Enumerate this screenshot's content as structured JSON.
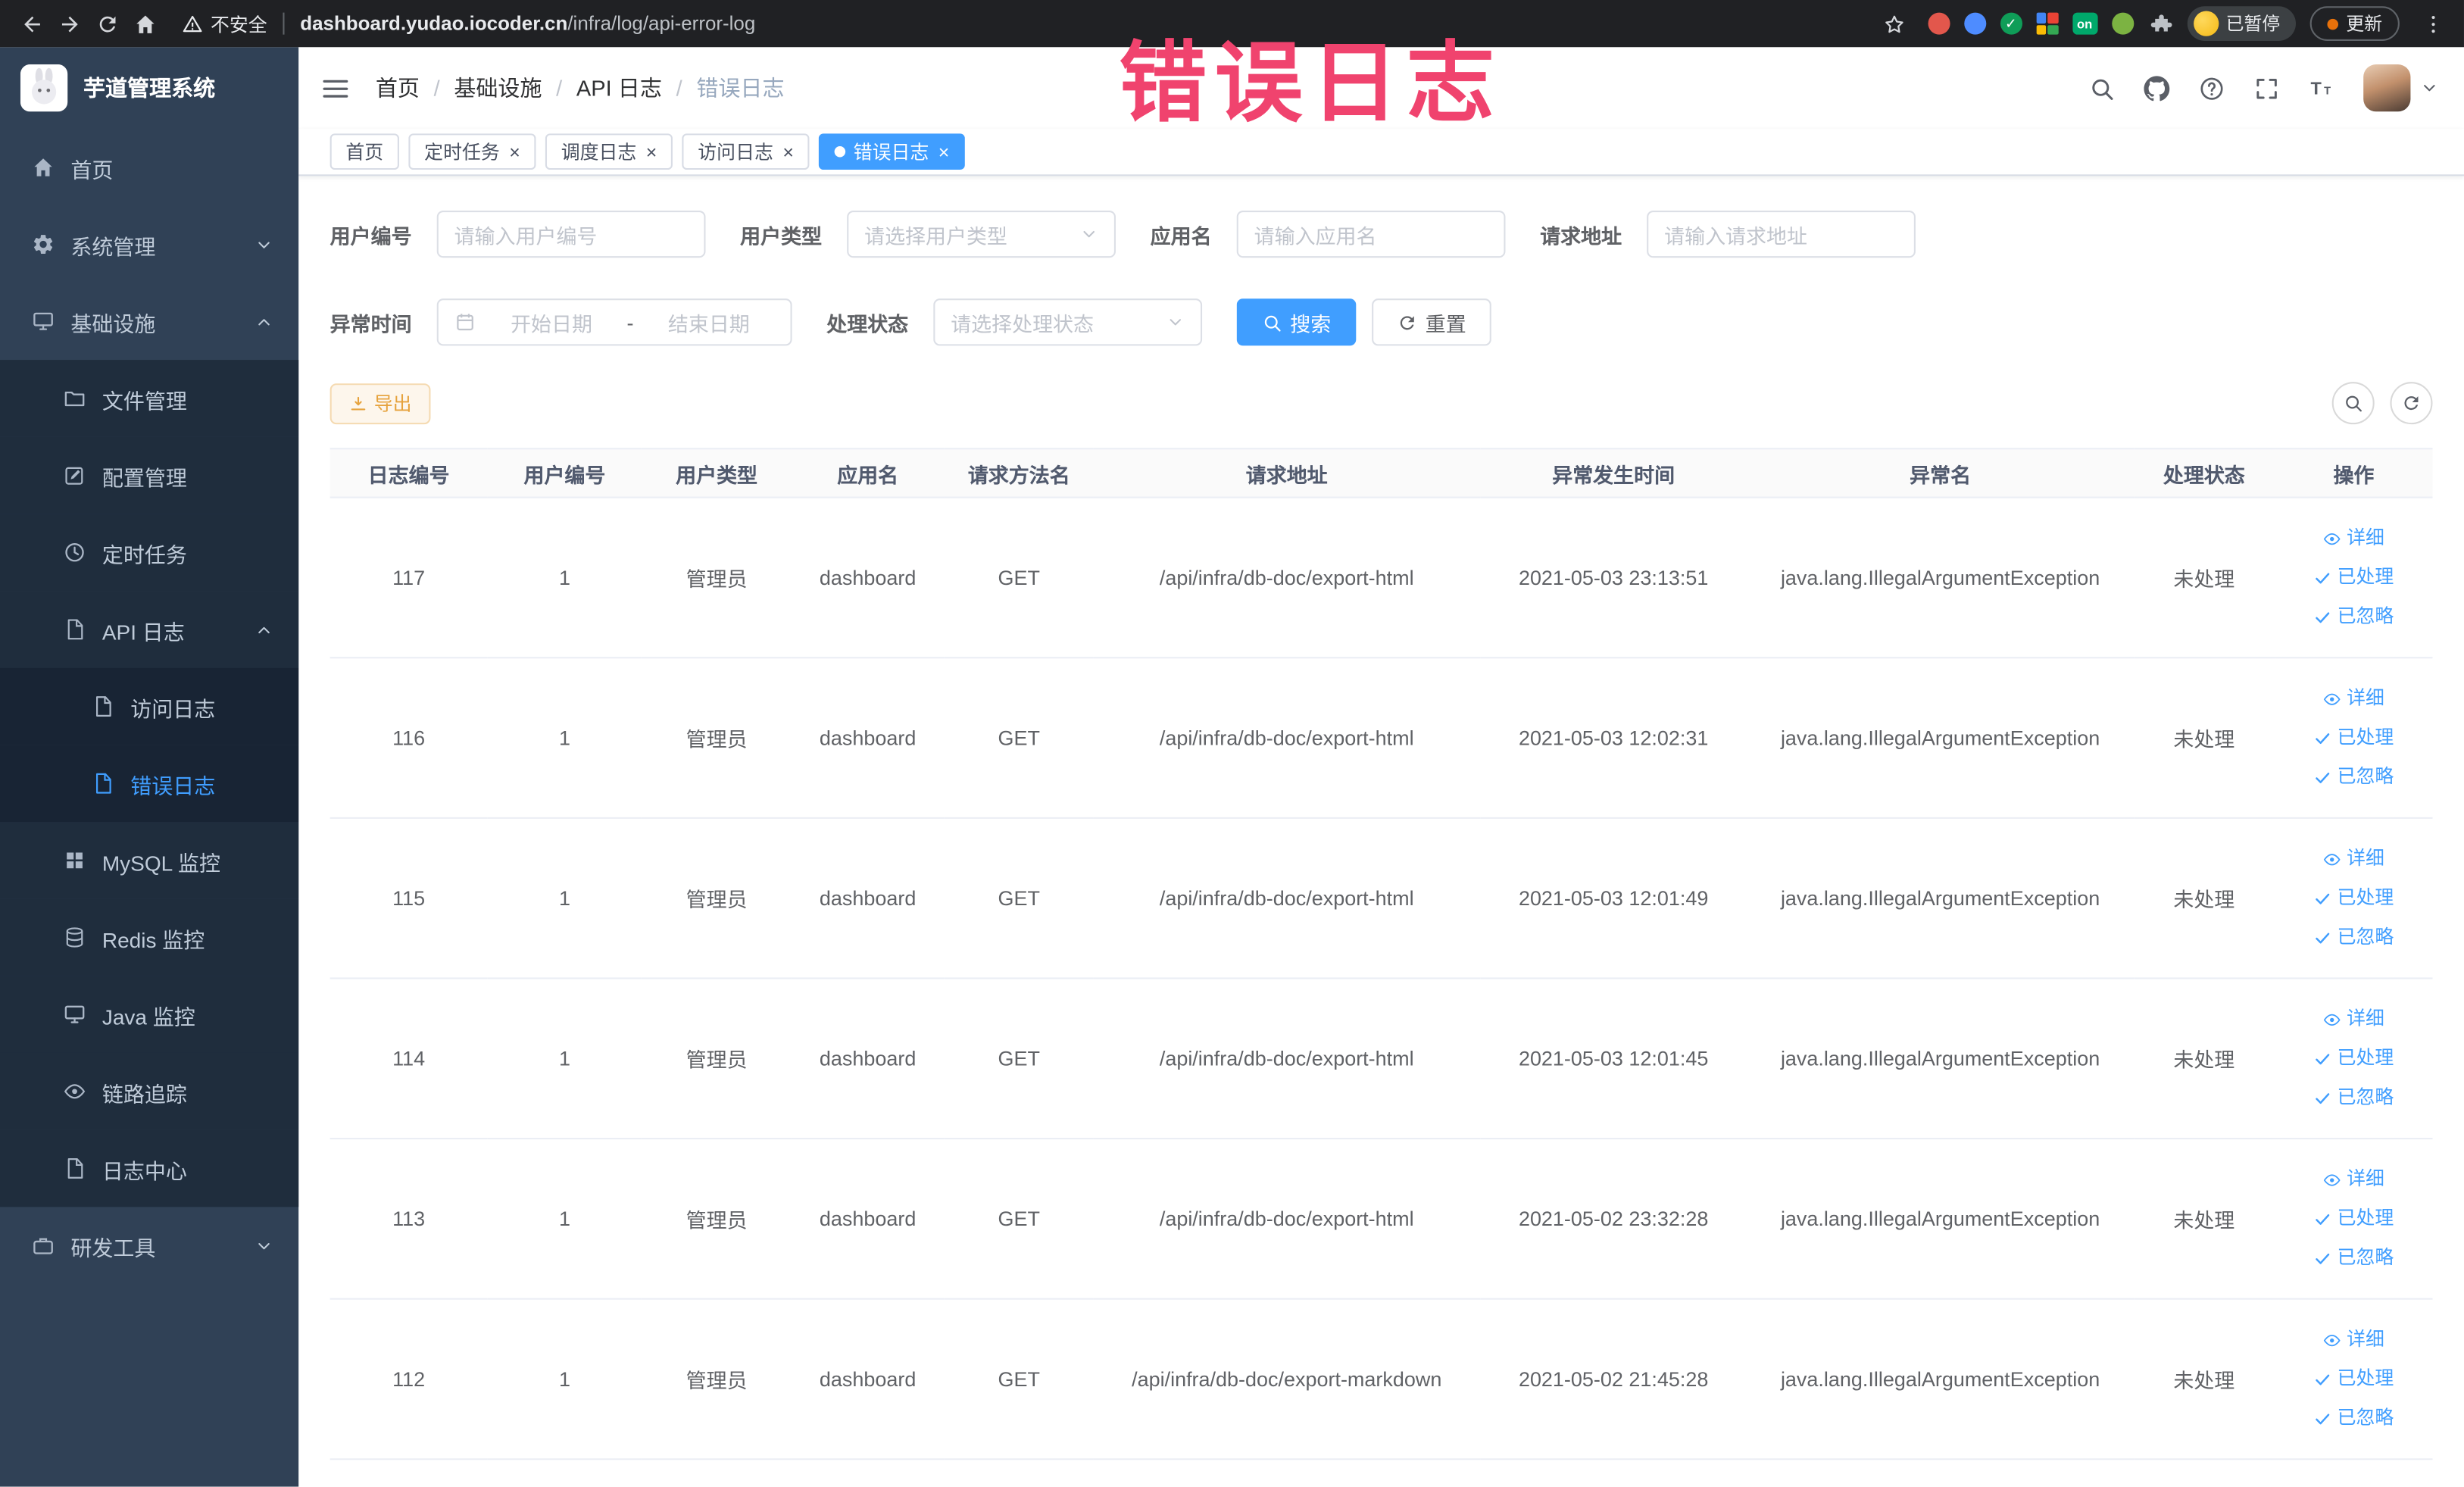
{
  "annotation": {
    "text": "错误日志",
    "color": "#f0436e"
  },
  "colors": {
    "accent": "#409eff",
    "sidebar_bg": "#304156",
    "submenu_bg": "#1f2d3d",
    "warning": "#e6a23c",
    "active_tab": "#409eff"
  },
  "browser": {
    "security_label": "不安全",
    "url_host": "dashboard.yudao.iocoder.cn",
    "url_path": "/infra/log/api-error-log",
    "profile_label": "已暂停",
    "update_label": "更新",
    "extensions": [
      {
        "name": "extension-red-icon",
        "type": "dot",
        "color": "#e2574c"
      },
      {
        "name": "extension-blue-icon",
        "type": "dot",
        "color": "#4e8cff"
      },
      {
        "name": "extension-green-check-icon",
        "type": "dot",
        "color": "#0f9d58",
        "glyph": "✓"
      },
      {
        "name": "extension-grid-icon",
        "type": "grid",
        "colors": [
          "#4285f4",
          "#ea4335",
          "#fbbc05",
          "#34a853"
        ]
      },
      {
        "name": "extension-on-badge",
        "type": "badge",
        "label": "on",
        "color": "#00a86b"
      },
      {
        "name": "extension-leaf-icon",
        "type": "dot",
        "color": "#7cb342"
      },
      {
        "name": "extension-puzzle-icon",
        "type": "icon",
        "icon": "puzzle-icon"
      }
    ]
  },
  "sidebar": {
    "app_title": "芋道管理系统",
    "items": [
      {
        "key": "home",
        "label": "首页",
        "icon": "home-icon",
        "level": 0
      },
      {
        "key": "system",
        "label": "系统管理",
        "icon": "gear-icon",
        "level": 0,
        "chevron": "down"
      },
      {
        "key": "infra",
        "label": "基础设施",
        "icon": "monitor-icon",
        "level": 0,
        "chevron": "up"
      },
      {
        "key": "file",
        "label": "文件管理",
        "icon": "folder-icon",
        "level": 1
      },
      {
        "key": "config",
        "label": "配置管理",
        "icon": "edit-icon",
        "level": 1
      },
      {
        "key": "job",
        "label": "定时任务",
        "icon": "clock-icon",
        "level": 1
      },
      {
        "key": "api-log",
        "label": "API 日志",
        "icon": "document-icon",
        "level": 1,
        "chevron": "up"
      },
      {
        "key": "access-log",
        "label": "访问日志",
        "icon": "document-icon",
        "level": 2
      },
      {
        "key": "error-log",
        "label": "错误日志",
        "icon": "document-icon",
        "level": 2,
        "active": true
      },
      {
        "key": "mysql",
        "label": "MySQL 监控",
        "icon": "grid-icon",
        "level": 1
      },
      {
        "key": "redis",
        "label": "Redis 监控",
        "icon": "database-icon",
        "level": 1
      },
      {
        "key": "java",
        "label": "Java 监控",
        "icon": "monitor-icon",
        "level": 1
      },
      {
        "key": "trace",
        "label": "链路追踪",
        "icon": "eye-icon",
        "level": 1
      },
      {
        "key": "log-center",
        "label": "日志中心",
        "icon": "document-icon",
        "level": 1
      },
      {
        "key": "dev-tools",
        "label": "研发工具",
        "icon": "briefcase-icon",
        "level": 0,
        "chevron": "down"
      }
    ]
  },
  "breadcrumb": {
    "separator": "/",
    "items": [
      "首页",
      "基础设施",
      "API 日志",
      "错误日志"
    ]
  },
  "header_actions": [
    {
      "key": "search",
      "icon": "search-icon"
    },
    {
      "key": "github",
      "icon": "github-icon"
    },
    {
      "key": "help",
      "icon": "question-icon"
    },
    {
      "key": "fullscreen",
      "icon": "fullscreen-icon"
    },
    {
      "key": "font-size",
      "icon": "font-size-icon"
    }
  ],
  "tabs": [
    {
      "key": "home",
      "label": "首页",
      "closable": false,
      "active": false
    },
    {
      "key": "job",
      "label": "定时任务",
      "closable": true,
      "active": false
    },
    {
      "key": "job-log",
      "label": "调度日志",
      "closable": true,
      "active": false
    },
    {
      "key": "access-log",
      "label": "访问日志",
      "closable": true,
      "active": false
    },
    {
      "key": "error-log",
      "label": "错误日志",
      "closable": true,
      "active": true
    }
  ],
  "filters": {
    "user_id": {
      "label": "用户编号",
      "placeholder": "请输入用户编号"
    },
    "user_type": {
      "label": "用户类型",
      "placeholder": "请选择用户类型"
    },
    "app_name": {
      "label": "应用名",
      "placeholder": "请输入应用名"
    },
    "request_url": {
      "label": "请求地址",
      "placeholder": "请输入请求地址"
    },
    "exception_time": {
      "label": "异常时间",
      "start_placeholder": "开始日期",
      "separator": "-",
      "end_placeholder": "结束日期"
    },
    "process_status": {
      "label": "处理状态",
      "placeholder": "请选择处理状态"
    },
    "search_button": "搜索",
    "reset_button": "重置"
  },
  "toolbar": {
    "export_button": "导出"
  },
  "table": {
    "columns": [
      "日志编号",
      "用户编号",
      "用户类型",
      "应用名",
      "请求方法名",
      "请求地址",
      "异常发生时间",
      "异常名",
      "处理状态",
      "操作"
    ],
    "actions": [
      {
        "key": "detail",
        "label": "详细",
        "icon": "eye-icon"
      },
      {
        "key": "processed",
        "label": "已处理",
        "icon": "check-icon"
      },
      {
        "key": "ignored",
        "label": "已忽略",
        "icon": "check-icon"
      }
    ],
    "rows": [
      {
        "id": "117",
        "user_id": "1",
        "user_type": "管理员",
        "app": "dashboard",
        "method": "GET",
        "url": "/api/infra/db-doc/export-html",
        "time": "2021-05-03 23:13:51",
        "exception": "java.lang.IllegalArgumentException",
        "status": "未处理"
      },
      {
        "id": "116",
        "user_id": "1",
        "user_type": "管理员",
        "app": "dashboard",
        "method": "GET",
        "url": "/api/infra/db-doc/export-html",
        "time": "2021-05-03 12:02:31",
        "exception": "java.lang.IllegalArgumentException",
        "status": "未处理"
      },
      {
        "id": "115",
        "user_id": "1",
        "user_type": "管理员",
        "app": "dashboard",
        "method": "GET",
        "url": "/api/infra/db-doc/export-html",
        "time": "2021-05-03 12:01:49",
        "exception": "java.lang.IllegalArgumentException",
        "status": "未处理"
      },
      {
        "id": "114",
        "user_id": "1",
        "user_type": "管理员",
        "app": "dashboard",
        "method": "GET",
        "url": "/api/infra/db-doc/export-html",
        "time": "2021-05-03 12:01:45",
        "exception": "java.lang.IllegalArgumentException",
        "status": "未处理"
      },
      {
        "id": "113",
        "user_id": "1",
        "user_type": "管理员",
        "app": "dashboard",
        "method": "GET",
        "url": "/api/infra/db-doc/export-html",
        "time": "2021-05-02 23:32:28",
        "exception": "java.lang.IllegalArgumentException",
        "status": "未处理"
      },
      {
        "id": "112",
        "user_id": "1",
        "user_type": "管理员",
        "app": "dashboard",
        "method": "GET",
        "url": "/api/infra/db-doc/export-markdown",
        "time": "2021-05-02 21:45:28",
        "exception": "java.lang.IllegalArgumentException",
        "status": "未处理"
      }
    ]
  }
}
